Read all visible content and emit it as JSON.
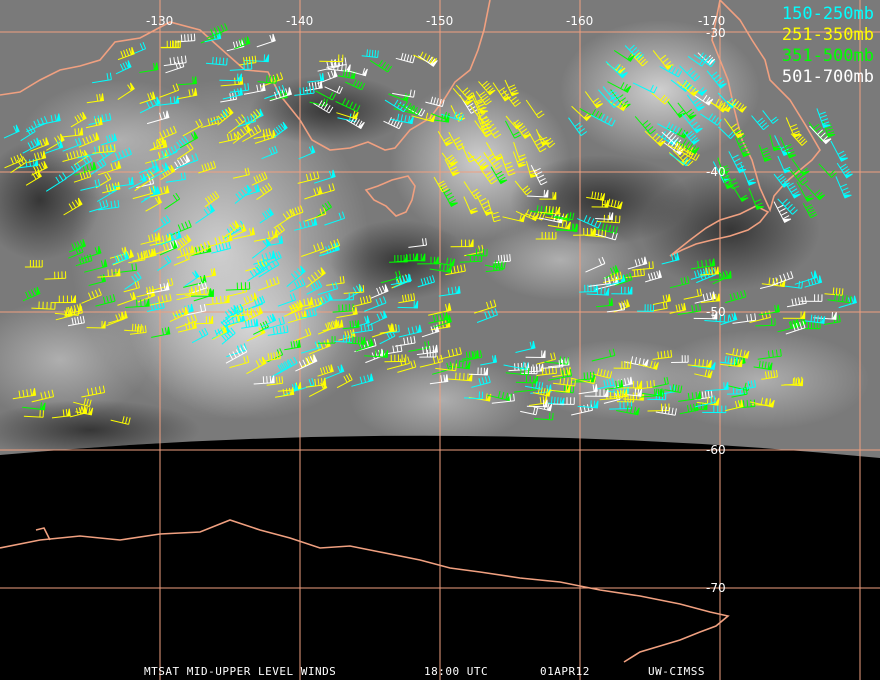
{
  "legend": [
    {
      "label": "150-250mb",
      "color": "#00ffff"
    },
    {
      "label": "251-350mb",
      "color": "#ffff00"
    },
    {
      "label": "351-500mb",
      "color": "#00ff00"
    },
    {
      "label": "501-700mb",
      "color": "#ffffff"
    }
  ],
  "grid": {
    "longitudes": [
      "-130",
      "-140",
      "-150",
      "-160",
      "-170"
    ],
    "latitudes": [
      "-30",
      "-40",
      "-50",
      "-60",
      "-70"
    ],
    "color": "#f0a080"
  },
  "coastline_color": "#f0a080",
  "caption": {
    "product": "MTSAT MID-UPPER LEVEL WINDS",
    "time": "18:00 UTC",
    "date": "01APR12",
    "source": "UW-CIMSS"
  }
}
